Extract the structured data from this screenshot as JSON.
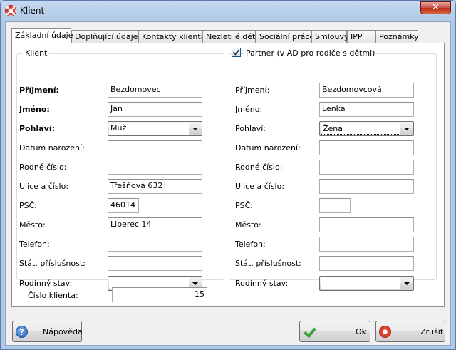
{
  "window": {
    "title": "Klient",
    "close_glyph": "✕",
    "icon": "lifebuoy-icon"
  },
  "tabs": [
    {
      "label": "Základní údaje",
      "active": true
    },
    {
      "label": "Doplňující údaje"
    },
    {
      "label": "Kontakty klienta"
    },
    {
      "label": "Nezletilé děti"
    },
    {
      "label": "Sociální práce"
    },
    {
      "label": "Smlouvy"
    },
    {
      "label": "IPP"
    },
    {
      "label": "Poznámky"
    }
  ],
  "klient": {
    "group_label": "Klient",
    "prijmeni_label": "Příjmení:",
    "prijmeni": "Bezdomovec",
    "jmeno_label": "Jméno:",
    "jmeno": "Jan",
    "pohlavi_label": "Pohlaví:",
    "pohlavi": "Muž",
    "datum_label": "Datum narození:",
    "datum": "",
    "rodne_label": "Rodné číslo:",
    "rodne": "",
    "ulice_label": "Ulice a číslo:",
    "ulice": "Třešňová 632",
    "psc_label": "PSČ:",
    "psc": "46014",
    "mesto_label": "Město:",
    "mesto": "Liberec 14",
    "telefon_label": "Telefon:",
    "telefon": "",
    "stat_label": "Stát. příslušnost:",
    "stat": "",
    "stav_label": "Rodinný stav:",
    "stav": ""
  },
  "partner": {
    "group_label": "Partner (v AD pro rodiče s dětmi)",
    "checked": true,
    "prijmeni_label": "Příjmení:",
    "prijmeni": "Bezdomovcová",
    "jmeno_label": "Jméno:",
    "jmeno": "Lenka",
    "pohlavi_label": "Pohlaví:",
    "pohlavi": "Žena",
    "datum_label": "Datum narození:",
    "datum": "",
    "rodne_label": "Rodné číslo:",
    "rodne": "",
    "ulice_label": "Ulice a číslo:",
    "ulice": "",
    "psc_label": "PSČ:",
    "psc": "",
    "mesto_label": "Město:",
    "mesto": "",
    "telefon_label": "Telefon:",
    "telefon": "",
    "stat_label": "Stát. příslušnost:",
    "stat": "",
    "stav_label": "Rodinný stav:",
    "stav": ""
  },
  "cislo_klienta": {
    "label": "Číslo klienta:",
    "value": "15"
  },
  "buttons": {
    "help": "Nápověda",
    "ok": "Ok",
    "cancel": "Zrušit"
  }
}
